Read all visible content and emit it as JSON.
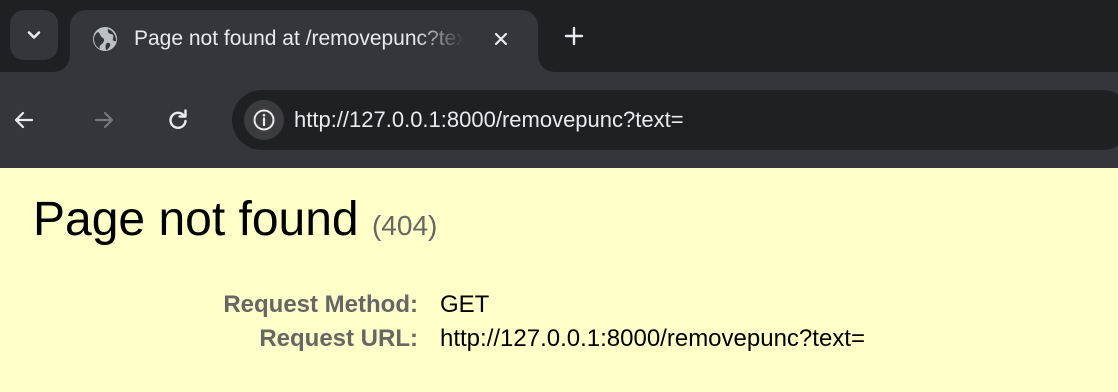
{
  "browser": {
    "tab": {
      "title": "Page not found at /removepunc?text=",
      "favicon": "globe-icon",
      "close_icon": "close-icon"
    },
    "new_tab_icon": "plus-icon",
    "tab_search_icon": "chevron-down-icon",
    "toolbar": {
      "back_icon": "arrow-left-icon",
      "forward_icon": "arrow-right-icon",
      "reload_icon": "reload-icon",
      "site_info_icon": "info-icon",
      "url": "http://127.0.0.1:8000/removepunc?text="
    },
    "colors": {
      "frame": "#1f2022",
      "toolbar": "#35363a",
      "text": "#e8eaed"
    }
  },
  "page": {
    "heading": "Page not found",
    "status_code": "(404)",
    "background": "#ffffc8",
    "details": [
      {
        "label": "Request Method:",
        "value": "GET"
      },
      {
        "label": "Request URL:",
        "value": "http://127.0.0.1:8000/removepunc?text="
      }
    ]
  }
}
